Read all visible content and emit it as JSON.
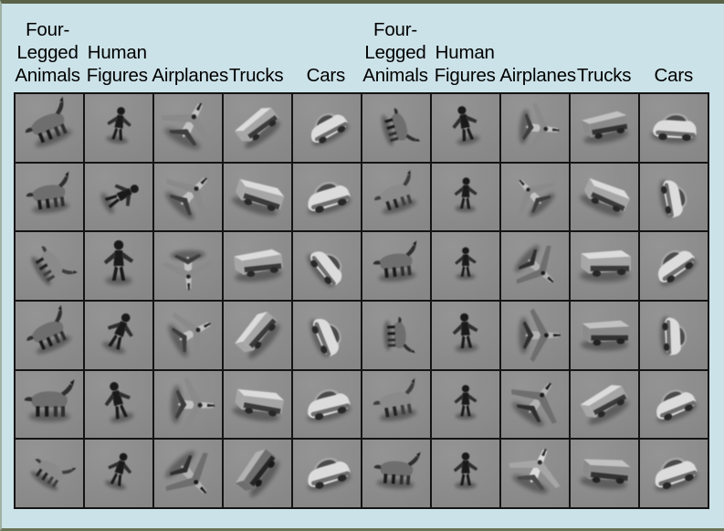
{
  "figure": {
    "background_color": "#cbe2e8",
    "grid_border_color": "#141414",
    "cell_background_color": "#8e8e8e",
    "top_rule_color": "#5a6347",
    "columns": 10,
    "rows": 6
  },
  "headers": [
    {
      "id": "four-legged-animals-left",
      "lines": [
        "Four-",
        "Legged",
        "Animals"
      ],
      "label": "Four-Legged Animals"
    },
    {
      "id": "human-figures-left",
      "lines": [
        "Human",
        "Figures"
      ],
      "label": "Human Figures"
    },
    {
      "id": "airplanes-left",
      "lines": [
        "Airplanes"
      ],
      "label": "Airplanes"
    },
    {
      "id": "trucks-left",
      "lines": [
        "Trucks"
      ],
      "label": "Trucks"
    },
    {
      "id": "cars-left",
      "lines": [
        "Cars"
      ],
      "label": "Cars"
    },
    {
      "id": "four-legged-animals-right",
      "lines": [
        "Four-",
        "Legged",
        "Animals"
      ],
      "label": "Four-Legged Animals"
    },
    {
      "id": "human-figures-right",
      "lines": [
        "Human",
        "Figures"
      ],
      "label": "Human Figures"
    },
    {
      "id": "airplanes-right",
      "lines": [
        "Airplanes"
      ],
      "label": "Airplanes"
    },
    {
      "id": "trucks-right",
      "lines": [
        "Trucks"
      ],
      "label": "Trucks"
    },
    {
      "id": "cars-right",
      "lines": [
        "Cars"
      ],
      "label": "Cars"
    }
  ],
  "grid": {
    "cells": [
      {
        "row": 1,
        "col": 1,
        "category": "four-legged-animal",
        "shape": "animal",
        "rot": -22,
        "scale": 1.05,
        "tone": "dark"
      },
      {
        "row": 1,
        "col": 2,
        "category": "human-figure",
        "shape": "human",
        "rot": 8,
        "scale": 0.9,
        "tone": "dark"
      },
      {
        "row": 1,
        "col": 3,
        "category": "airplane",
        "shape": "plane",
        "rot": 28,
        "scale": 1.15,
        "tone": "mid"
      },
      {
        "row": 1,
        "col": 4,
        "category": "truck",
        "shape": "truck",
        "rot": -36,
        "scale": 1.0,
        "tone": "light"
      },
      {
        "row": 1,
        "col": 5,
        "category": "car",
        "shape": "car",
        "rot": -28,
        "scale": 1.0,
        "tone": "light"
      },
      {
        "row": 1,
        "col": 6,
        "category": "four-legged-animal",
        "shape": "animal",
        "rot": 74,
        "scale": 0.85,
        "tone": "dark"
      },
      {
        "row": 1,
        "col": 7,
        "category": "human-figure",
        "shape": "human",
        "rot": -12,
        "scale": 0.95,
        "tone": "dark"
      },
      {
        "row": 1,
        "col": 8,
        "category": "airplane",
        "shape": "plane",
        "rot": 96,
        "scale": 1.0,
        "tone": "mid"
      },
      {
        "row": 1,
        "col": 9,
        "category": "truck",
        "shape": "truck",
        "rot": -10,
        "scale": 1.05,
        "tone": "mid"
      },
      {
        "row": 1,
        "col": 10,
        "category": "car",
        "shape": "car",
        "rot": 4,
        "scale": 1.1,
        "tone": "light"
      },
      {
        "row": 2,
        "col": 1,
        "category": "four-legged-animal",
        "shape": "animal",
        "rot": -8,
        "scale": 1.0,
        "tone": "dark"
      },
      {
        "row": 2,
        "col": 2,
        "category": "human-figure",
        "shape": "human",
        "rot": 62,
        "scale": 0.95,
        "tone": "dark"
      },
      {
        "row": 2,
        "col": 3,
        "category": "airplane",
        "shape": "plane",
        "rot": 44,
        "scale": 1.1,
        "tone": "mid"
      },
      {
        "row": 2,
        "col": 4,
        "category": "truck",
        "shape": "truck",
        "rot": 18,
        "scale": 1.1,
        "tone": "light"
      },
      {
        "row": 2,
        "col": 5,
        "category": "car",
        "shape": "car",
        "rot": -16,
        "scale": 1.1,
        "tone": "light"
      },
      {
        "row": 2,
        "col": 6,
        "category": "four-legged-animal",
        "shape": "animal",
        "rot": -18,
        "scale": 0.95,
        "tone": "mid"
      },
      {
        "row": 2,
        "col": 7,
        "category": "human-figure",
        "shape": "human",
        "rot": 2,
        "scale": 0.85,
        "tone": "dark"
      },
      {
        "row": 2,
        "col": 8,
        "category": "airplane",
        "shape": "plane",
        "rot": -42,
        "scale": 0.95,
        "tone": "mid"
      },
      {
        "row": 2,
        "col": 9,
        "category": "truck",
        "shape": "truck",
        "rot": 24,
        "scale": 1.05,
        "tone": "light"
      },
      {
        "row": 2,
        "col": 10,
        "category": "car",
        "shape": "car",
        "rot": 80,
        "scale": 0.95,
        "tone": "light"
      },
      {
        "row": 3,
        "col": 1,
        "category": "four-legged-animal",
        "shape": "animal",
        "rot": 58,
        "scale": 0.9,
        "tone": "mid"
      },
      {
        "row": 3,
        "col": 2,
        "category": "human-figure",
        "shape": "human",
        "rot": 0,
        "scale": 1.1,
        "tone": "dark"
      },
      {
        "row": 3,
        "col": 3,
        "category": "airplane",
        "shape": "plane",
        "rot": 178,
        "scale": 1.0,
        "tone": "mid"
      },
      {
        "row": 3,
        "col": 4,
        "category": "truck",
        "shape": "truck",
        "rot": -6,
        "scale": 1.1,
        "tone": "light"
      },
      {
        "row": 3,
        "col": 5,
        "category": "car",
        "shape": "car",
        "rot": 52,
        "scale": 1.0,
        "tone": "light"
      },
      {
        "row": 3,
        "col": 6,
        "category": "four-legged-animal",
        "shape": "animal",
        "rot": -6,
        "scale": 1.0,
        "tone": "dark"
      },
      {
        "row": 3,
        "col": 7,
        "category": "human-figure",
        "shape": "human",
        "rot": 0,
        "scale": 0.8,
        "tone": "dark"
      },
      {
        "row": 3,
        "col": 8,
        "category": "airplane",
        "shape": "plane",
        "rot": 132,
        "scale": 1.0,
        "tone": "dark"
      },
      {
        "row": 3,
        "col": 9,
        "category": "truck",
        "shape": "truck",
        "rot": 0,
        "scale": 1.15,
        "tone": "light"
      },
      {
        "row": 3,
        "col": 10,
        "category": "car",
        "shape": "car",
        "rot": -34,
        "scale": 1.05,
        "tone": "light"
      },
      {
        "row": 4,
        "col": 1,
        "category": "four-legged-animal",
        "shape": "animal",
        "rot": -24,
        "scale": 1.0,
        "tone": "dark"
      },
      {
        "row": 4,
        "col": 2,
        "category": "human-figure",
        "shape": "human",
        "rot": 22,
        "scale": 1.0,
        "tone": "dark"
      },
      {
        "row": 4,
        "col": 3,
        "category": "airplane",
        "shape": "plane",
        "rot": 62,
        "scale": 1.05,
        "tone": "mid"
      },
      {
        "row": 4,
        "col": 4,
        "category": "truck",
        "shape": "truck",
        "rot": -48,
        "scale": 1.05,
        "tone": "light"
      },
      {
        "row": 4,
        "col": 5,
        "category": "car",
        "shape": "car",
        "rot": 68,
        "scale": 1.0,
        "tone": "light"
      },
      {
        "row": 4,
        "col": 6,
        "category": "four-legged-animal",
        "shape": "animal",
        "rot": 88,
        "scale": 0.8,
        "tone": "dark"
      },
      {
        "row": 4,
        "col": 7,
        "category": "human-figure",
        "shape": "human",
        "rot": -4,
        "scale": 0.95,
        "tone": "dark"
      },
      {
        "row": 4,
        "col": 8,
        "category": "airplane",
        "shape": "plane",
        "rot": 90,
        "scale": 1.05,
        "tone": "dark"
      },
      {
        "row": 4,
        "col": 9,
        "category": "truck",
        "shape": "truck",
        "rot": 0,
        "scale": 1.1,
        "tone": "mid"
      },
      {
        "row": 4,
        "col": 10,
        "category": "car",
        "shape": "car",
        "rot": 88,
        "scale": 0.95,
        "tone": "light"
      },
      {
        "row": 5,
        "col": 1,
        "category": "four-legged-animal",
        "shape": "animal",
        "rot": 0,
        "scale": 1.1,
        "tone": "dark"
      },
      {
        "row": 5,
        "col": 2,
        "category": "human-figure",
        "shape": "human",
        "rot": -14,
        "scale": 1.0,
        "tone": "dark"
      },
      {
        "row": 5,
        "col": 3,
        "category": "airplane",
        "shape": "plane",
        "rot": 92,
        "scale": 1.1,
        "tone": "mid"
      },
      {
        "row": 5,
        "col": 4,
        "category": "truck",
        "shape": "truck",
        "rot": 10,
        "scale": 1.1,
        "tone": "light"
      },
      {
        "row": 5,
        "col": 5,
        "category": "car",
        "shape": "car",
        "rot": -14,
        "scale": 1.1,
        "tone": "light"
      },
      {
        "row": 5,
        "col": 6,
        "category": "four-legged-animal",
        "shape": "animal",
        "rot": -10,
        "scale": 1.0,
        "tone": "mid"
      },
      {
        "row": 5,
        "col": 7,
        "category": "human-figure",
        "shape": "human",
        "rot": 0,
        "scale": 0.85,
        "tone": "dark"
      },
      {
        "row": 5,
        "col": 8,
        "category": "airplane",
        "shape": "plane",
        "rot": 36,
        "scale": 1.1,
        "tone": "dark"
      },
      {
        "row": 5,
        "col": 9,
        "category": "truck",
        "shape": "truck",
        "rot": -28,
        "scale": 1.05,
        "tone": "light"
      },
      {
        "row": 5,
        "col": 10,
        "category": "car",
        "shape": "car",
        "rot": -22,
        "scale": 1.05,
        "tone": "light"
      },
      {
        "row": 6,
        "col": 1,
        "category": "four-legged-animal",
        "shape": "animal",
        "rot": 34,
        "scale": 0.85,
        "tone": "mid"
      },
      {
        "row": 6,
        "col": 2,
        "category": "human-figure",
        "shape": "human",
        "rot": 16,
        "scale": 0.9,
        "tone": "dark"
      },
      {
        "row": 6,
        "col": 3,
        "category": "airplane",
        "shape": "plane",
        "rot": 138,
        "scale": 1.1,
        "tone": "dark"
      },
      {
        "row": 6,
        "col": 4,
        "category": "truck",
        "shape": "truck",
        "rot": -52,
        "scale": 1.05,
        "tone": "dark"
      },
      {
        "row": 6,
        "col": 5,
        "category": "car",
        "shape": "car",
        "rot": -16,
        "scale": 1.1,
        "tone": "light"
      },
      {
        "row": 6,
        "col": 6,
        "category": "four-legged-animal",
        "shape": "animal",
        "rot": 4,
        "scale": 1.0,
        "tone": "dark"
      },
      {
        "row": 6,
        "col": 7,
        "category": "human-figure",
        "shape": "human",
        "rot": 0,
        "scale": 0.9,
        "tone": "dark"
      },
      {
        "row": 6,
        "col": 8,
        "category": "airplane",
        "shape": "plane",
        "rot": 24,
        "scale": 1.1,
        "tone": "light"
      },
      {
        "row": 6,
        "col": 9,
        "category": "truck",
        "shape": "truck",
        "rot": 6,
        "scale": 1.1,
        "tone": "mid"
      },
      {
        "row": 6,
        "col": 10,
        "category": "car",
        "shape": "car",
        "rot": -18,
        "scale": 1.1,
        "tone": "light"
      }
    ]
  }
}
